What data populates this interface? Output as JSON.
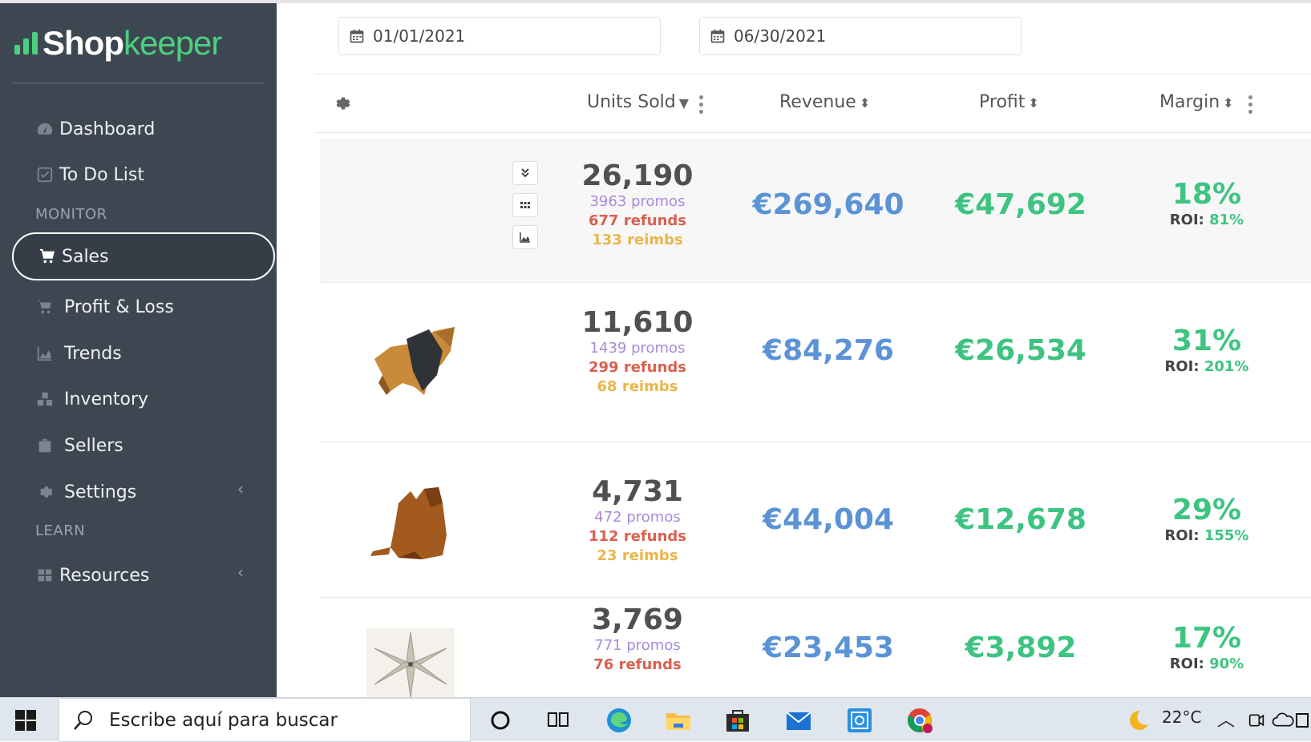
{
  "app": {
    "logo_part1": "Shop",
    "logo_part2": "keeper",
    "brand_color": "#4bd07f"
  },
  "sidebar": {
    "items": [
      {
        "label": "Dashboard",
        "icon": "dashboard-icon"
      },
      {
        "label": "To Do List",
        "icon": "checkbox-icon"
      },
      {
        "label": "Sales",
        "icon": "cart-icon",
        "active": true
      },
      {
        "label": "Profit & Loss",
        "icon": "cart-icon"
      },
      {
        "label": "Trends",
        "icon": "area-chart-icon"
      },
      {
        "label": "Inventory",
        "icon": "cubes-icon"
      },
      {
        "label": "Sellers",
        "icon": "briefcase-icon"
      },
      {
        "label": "Settings",
        "icon": "gear-icon"
      },
      {
        "label": "Resources",
        "icon": "grid-icon"
      }
    ],
    "sections": {
      "monitor": "MONITOR",
      "learn": "LEARN"
    }
  },
  "filters": {
    "start_date": "01/01/2021",
    "end_date": "06/30/2021"
  },
  "table": {
    "columns": {
      "units": "Units Sold",
      "revenue": "Revenue",
      "profit": "Profit",
      "margin": "Margin"
    },
    "roi_label": "ROI:",
    "rows": [
      {
        "units": "26,190",
        "promos": "3963 promos",
        "refunds": "677 refunds",
        "reimbs": "133 reimbs",
        "revenue": "€269,640",
        "profit": "€47,692",
        "margin": "18%",
        "roi": "81%"
      },
      {
        "units": "11,610",
        "promos": "1439 promos",
        "refunds": "299 refunds",
        "reimbs": "68 reimbs",
        "revenue": "€84,276",
        "profit": "€26,534",
        "margin": "31%",
        "roi": "201%"
      },
      {
        "units": "4,731",
        "promos": "472 promos",
        "refunds": "112 refunds",
        "reimbs": "23 reimbs",
        "revenue": "€44,004",
        "profit": "€12,678",
        "margin": "29%",
        "roi": "155%"
      },
      {
        "units": "3,769",
        "promos": "771 promos",
        "refunds": "76 refunds",
        "revenue": "€23,453",
        "profit": "€3,892",
        "margin": "17%",
        "roi": "90%"
      }
    ]
  },
  "taskbar": {
    "search_placeholder": "Escribe aquí para buscar",
    "temperature": "22°C"
  }
}
